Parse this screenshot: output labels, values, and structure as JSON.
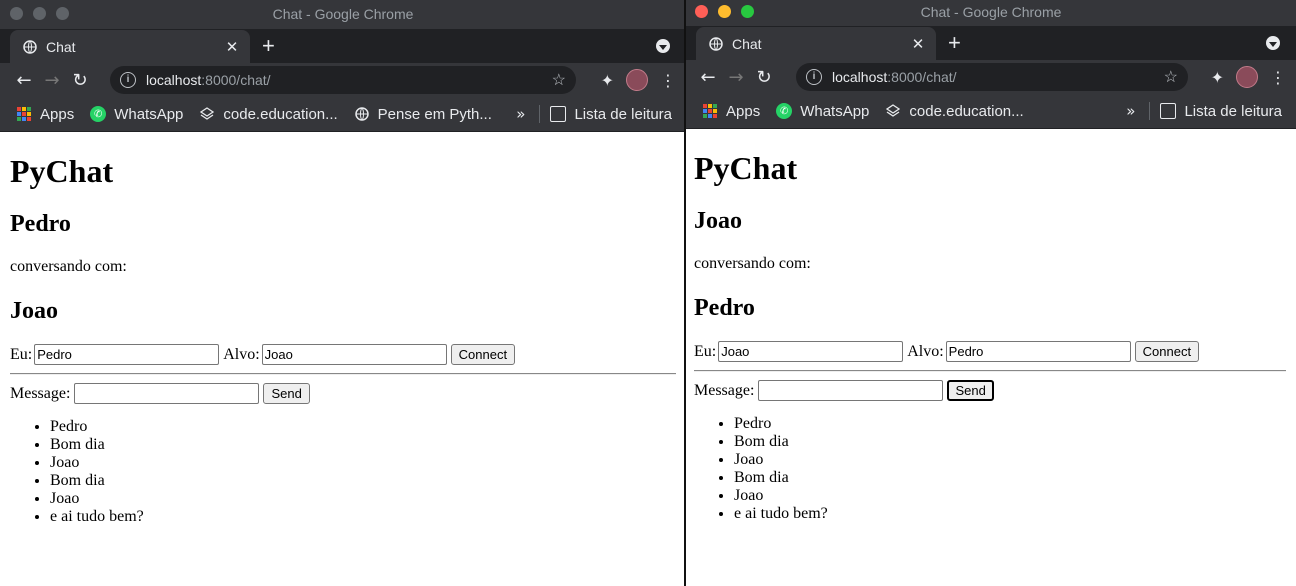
{
  "windows": [
    {
      "window_title": "Chat - Google Chrome",
      "tab_title": "Chat",
      "url_host": "localhost",
      "url_path": ":8000/chat/",
      "bookmarks": [
        "Apps",
        "WhatsApp",
        "code.education...",
        "Pense em Pyth..."
      ],
      "reading_list": "Lista de leitura",
      "page": {
        "heading": "PyChat",
        "user": "Pedro",
        "talking_label": "conversando com:",
        "target": "Joao",
        "eu_label": "Eu:",
        "eu_value": "Pedro",
        "alvo_label": "Alvo:",
        "alvo_value": "Joao",
        "connect_label": "Connect",
        "message_label": "Message:",
        "message_value": "",
        "send_label": "Send",
        "messages": [
          "Pedro",
          "Bom dia",
          "Joao",
          "Bom dia",
          "Joao",
          "e ai tudo bem?"
        ]
      }
    },
    {
      "window_title": "Chat - Google Chrome",
      "tab_title": "Chat",
      "url_host": "localhost",
      "url_path": ":8000/chat/",
      "bookmarks": [
        "Apps",
        "WhatsApp",
        "code.education..."
      ],
      "reading_list": "Lista de leitura",
      "page": {
        "heading": "PyChat",
        "user": "Joao",
        "talking_label": "conversando com:",
        "target": "Pedro",
        "eu_label": "Eu:",
        "eu_value": "Joao",
        "alvo_label": "Alvo:",
        "alvo_value": "Pedro",
        "connect_label": "Connect",
        "message_label": "Message:",
        "message_value": "",
        "send_label": "Send",
        "messages": [
          "Pedro",
          "Bom dia",
          "Joao",
          "Bom dia",
          "Joao",
          "e ai tudo bem?"
        ]
      }
    }
  ]
}
